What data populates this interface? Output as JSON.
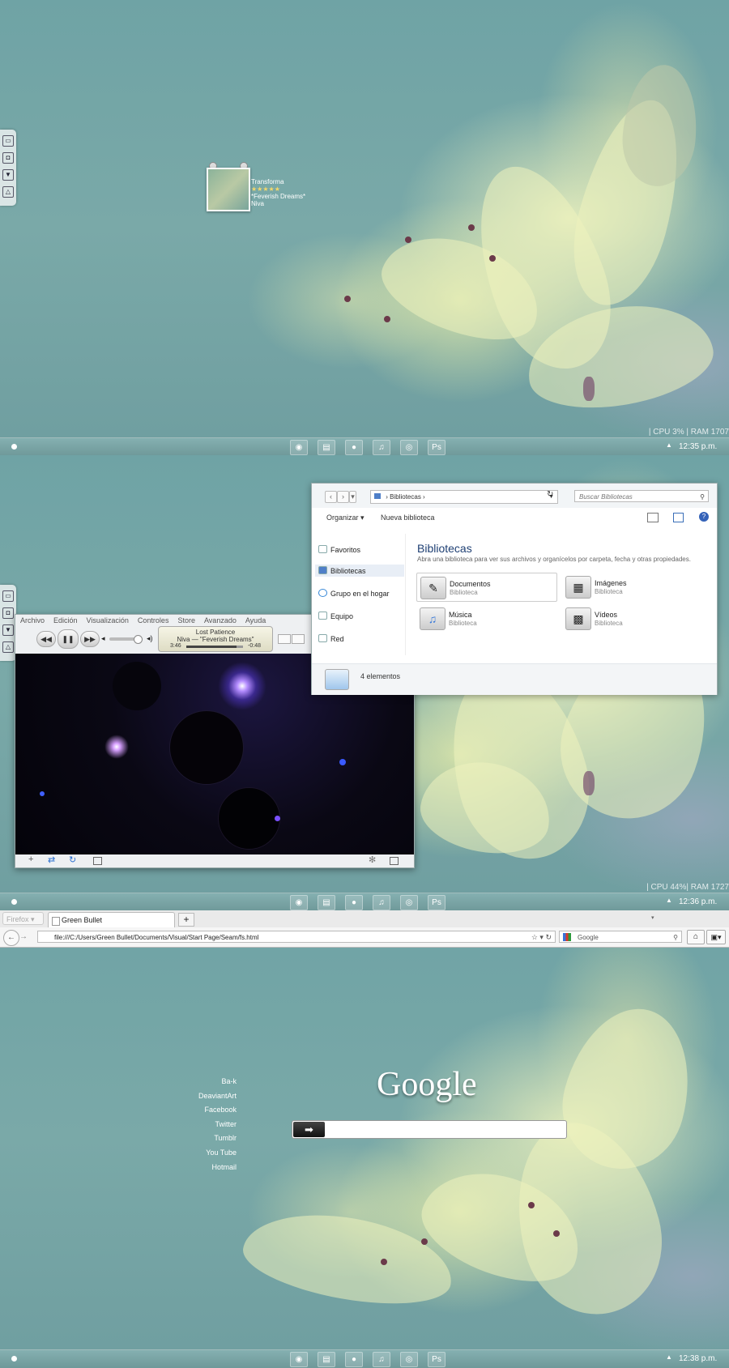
{
  "desktop": {
    "now_playing": {
      "line1": "Transforma",
      "stars": "★★★★★",
      "line2": "*Feverish Dreams*",
      "line3": "Niva"
    },
    "sysmon_1": "| CPU 3%  | RAM 1707",
    "sysmon_2": "| CPU 44%| RAM 1727",
    "clock_1": "12:35 p.m.",
    "clock_2": "12:36 p.m.",
    "clock_3": "12:38 p.m.",
    "tray_arrow": "▲"
  },
  "explorer": {
    "breadcrumb": "Bibliotecas",
    "search_placeholder": "Buscar Bibliotecas",
    "organize": "Organizar ▾",
    "new_library": "Nueva biblioteca",
    "sidebar": [
      "Favoritos",
      "Bibliotecas",
      "Grupo en el hogar",
      "Equipo",
      "Red"
    ],
    "title": "Bibliotecas",
    "description": "Abra una biblioteca para ver sus archivos y organícelos por carpeta, fecha y otras propiedades.",
    "libraries": [
      {
        "name": "Documentos",
        "sub": "Biblioteca"
      },
      {
        "name": "Imágenes",
        "sub": "Biblioteca"
      },
      {
        "name": "Música",
        "sub": "Biblioteca"
      },
      {
        "name": "Vídeos",
        "sub": "Biblioteca"
      }
    ],
    "status": "4 elementos"
  },
  "player": {
    "menu": [
      "Archivo",
      "Edición",
      "Visualización",
      "Controles",
      "Store",
      "Avanzado",
      "Ayuda"
    ],
    "track": "Lost Patience",
    "artist_line": "Niva — \"Feverish Dreams\"",
    "elapsed": "3:46",
    "remaining": "-0:48",
    "progress": 0.88
  },
  "browser": {
    "app_button": "Firefox ▾",
    "tab_title": "Green Bullet",
    "url": "file:///C:/Users/Green Bullet/Documents/Visual/Start Page/Seam/fs.html",
    "search_engine": "Google",
    "new_tab": "+",
    "page": {
      "logo": "Google",
      "links": [
        "Ba-k",
        "DeaviantArt",
        "Facebook",
        "Twitter",
        "Tumblr",
        "You Tube",
        "Hotmail"
      ]
    }
  }
}
